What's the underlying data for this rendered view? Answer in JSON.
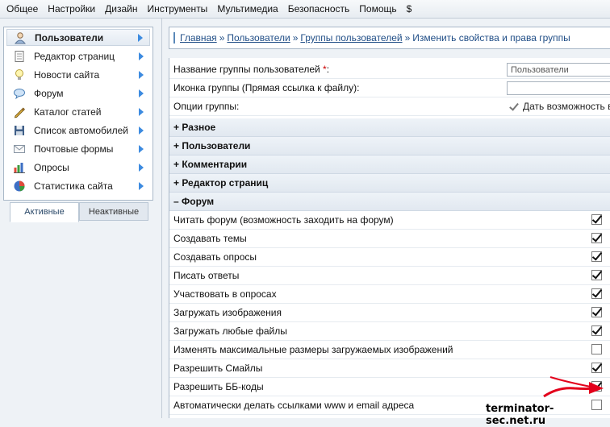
{
  "menu": [
    "Общее",
    "Настройки",
    "Дизайн",
    "Инструменты",
    "Мультимедиа",
    "Безопасность",
    "Помощь",
    "$"
  ],
  "sidebar": {
    "items": [
      {
        "label": "Пользователи",
        "icon": "user-icon",
        "active": true
      },
      {
        "label": "Редактор страниц",
        "icon": "page-icon"
      },
      {
        "label": "Новости сайта",
        "icon": "lightbulb-icon"
      },
      {
        "label": "Форум",
        "icon": "chat-bubble-icon"
      },
      {
        "label": "Каталог статей",
        "icon": "pencil-icon"
      },
      {
        "label": "Список автомобилей",
        "icon": "floppy-disk-icon"
      },
      {
        "label": "Почтовые формы",
        "icon": "envelope-icon"
      },
      {
        "label": "Опросы",
        "icon": "bar-chart-icon"
      },
      {
        "label": "Статистика сайта",
        "icon": "pie-chart-icon"
      }
    ],
    "tabs": [
      "Активные",
      "Неактивные"
    ]
  },
  "breadcrumb": {
    "links": [
      "Главная",
      "Пользователи",
      "Группы пользователей"
    ],
    "current": "Изменить свойства и права группы",
    "separator": "»"
  },
  "form": {
    "group_name_label": "Название группы пользователей",
    "required_mark": "*",
    "colon": ":",
    "group_name_value": "Пользователи",
    "icon_label": "Иконка группы (Прямая ссылка к файлу):",
    "icon_value": "",
    "options_label": "Опции группы:",
    "options_check_text": "Дать возможность вы",
    "sections": [
      {
        "label": "+ Разное"
      },
      {
        "label": "+ Пользователи"
      },
      {
        "label": "+ Комментарии"
      },
      {
        "label": "+ Редактор страниц"
      },
      {
        "label": "– Форум"
      }
    ],
    "permissions": [
      {
        "label": "Читать форум (возможность заходить на форум)",
        "checked": true
      },
      {
        "label": "Создавать темы",
        "checked": true
      },
      {
        "label": "Создавать опросы",
        "checked": true
      },
      {
        "label": "Писать ответы",
        "checked": true
      },
      {
        "label": "Участвовать в опросах",
        "checked": true
      },
      {
        "label": "Загружать изображения",
        "checked": true
      },
      {
        "label": "Загружать любые файлы",
        "checked": true
      },
      {
        "label": "Изменять максимальные размеры загружаемых изображений",
        "checked": false
      },
      {
        "label": "Разрешить Смайлы",
        "checked": true
      },
      {
        "label": "Разрешить ББ-коды",
        "checked": true
      },
      {
        "label": "Автоматически делать ссылками www и email адреса",
        "checked": false
      }
    ]
  },
  "watermark": "terminator-sec.net.ru",
  "colors": {
    "accent": "#3d8be0",
    "link": "#1f4d86",
    "arrow": "#e3001b"
  }
}
